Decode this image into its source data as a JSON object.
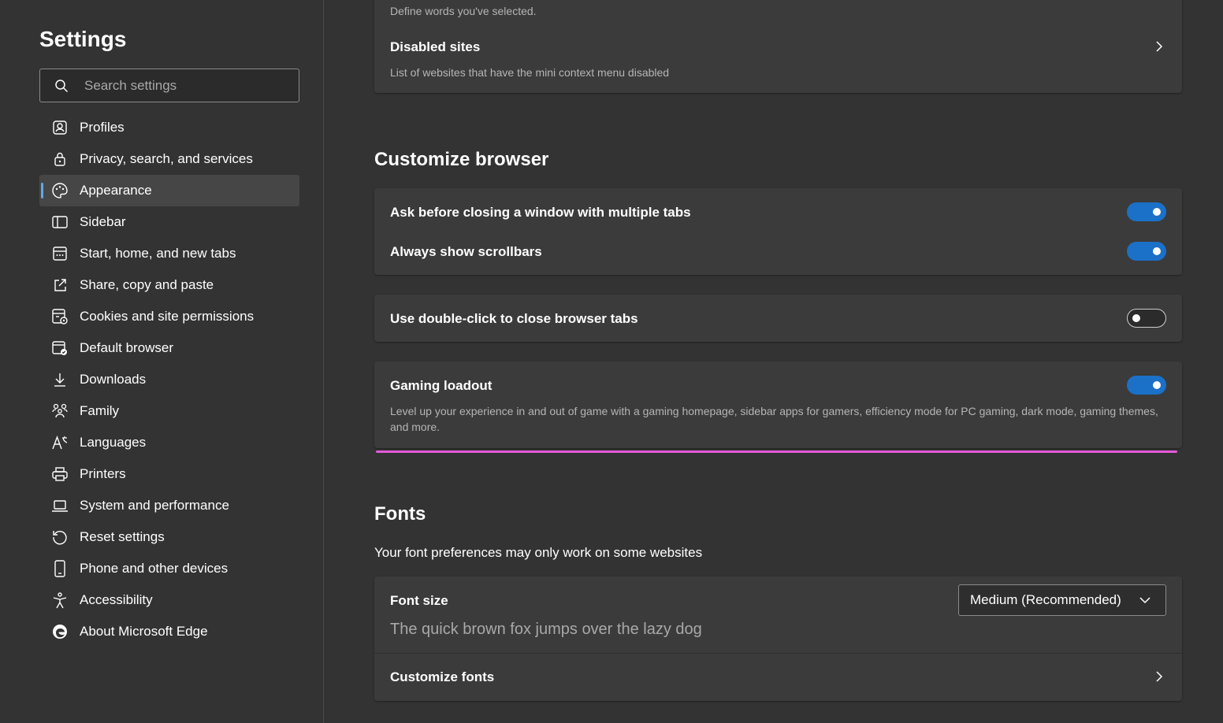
{
  "sidebar": {
    "title": "Settings",
    "search_placeholder": "Search settings",
    "items": [
      {
        "label": "Profiles",
        "icon": "profile-icon"
      },
      {
        "label": "Privacy, search, and services",
        "icon": "lock-icon"
      },
      {
        "label": "Appearance",
        "icon": "palette-icon",
        "active": true
      },
      {
        "label": "Sidebar",
        "icon": "sidebar-icon"
      },
      {
        "label": "Start, home, and new tabs",
        "icon": "home-tabs-icon"
      },
      {
        "label": "Share, copy and paste",
        "icon": "share-icon"
      },
      {
        "label": "Cookies and site permissions",
        "icon": "cookies-icon"
      },
      {
        "label": "Default browser",
        "icon": "default-browser-icon"
      },
      {
        "label": "Downloads",
        "icon": "download-icon"
      },
      {
        "label": "Family",
        "icon": "family-icon"
      },
      {
        "label": "Languages",
        "icon": "languages-icon"
      },
      {
        "label": "Printers",
        "icon": "printer-icon"
      },
      {
        "label": "System and performance",
        "icon": "laptop-icon"
      },
      {
        "label": "Reset settings",
        "icon": "reset-icon"
      },
      {
        "label": "Phone and other devices",
        "icon": "phone-icon"
      },
      {
        "label": "Accessibility",
        "icon": "accessibility-icon"
      },
      {
        "label": "About Microsoft Edge",
        "icon": "edge-icon"
      }
    ]
  },
  "main": {
    "top_card": {
      "define_words_desc": "Define words you've selected.",
      "disabled_sites_title": "Disabled sites",
      "disabled_sites_desc": "List of websites that have the mini context menu disabled"
    },
    "customize": {
      "title": "Customize browser",
      "ask_before_closing": "Ask before closing a window with multiple tabs",
      "always_show_scrollbars": "Always show scrollbars",
      "double_click_close": "Use double-click to close browser tabs",
      "gaming_title": "Gaming loadout",
      "gaming_desc": "Level up your experience in and out of game with a gaming homepage, sidebar apps for gamers, efficiency mode for PC gaming, dark mode, gaming themes, and more."
    },
    "fonts": {
      "title": "Fonts",
      "subtitle": "Your font preferences may only work on some websites",
      "font_size_label": "Font size",
      "font_size_value": "Medium (Recommended)",
      "preview": "The quick brown fox jumps over the lazy dog",
      "customize_fonts": "Customize fonts"
    }
  },
  "colors": {
    "accent": "#1b70c8",
    "highlight_bar": "#e45ad8"
  }
}
